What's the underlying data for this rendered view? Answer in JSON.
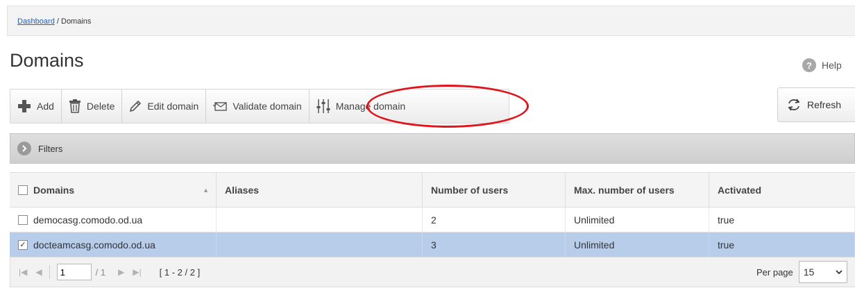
{
  "breadcrumb": {
    "link": "Dashboard",
    "separator": " / ",
    "current": "Domains"
  },
  "page": {
    "title": "Domains"
  },
  "help": {
    "label": "Help",
    "icon": "question-icon"
  },
  "toolbar": {
    "add": "Add",
    "delete": "Delete",
    "edit": "Edit domain",
    "validate": "Validate domain",
    "manage": "Manage domain",
    "refresh": "Refresh"
  },
  "filters": {
    "label": "Filters"
  },
  "table": {
    "columns": [
      "Domains",
      "Aliases",
      "Number of users",
      "Max. number of users",
      "Activated"
    ],
    "rows": [
      {
        "domain": "democasg.comodo.od.ua",
        "aliases": "",
        "users": "2",
        "max_users": "Unlimited",
        "activated": "true",
        "checked": false,
        "selected": false
      },
      {
        "domain": "docteamcasg.comodo.od.ua",
        "aliases": "",
        "users": "3",
        "max_users": "Unlimited",
        "activated": "true",
        "checked": true,
        "selected": true
      }
    ]
  },
  "pager": {
    "page": "1",
    "total": "/ 1",
    "range": "[ 1 - 2 / 2 ]",
    "per_page_label": "Per page",
    "per_page_value": "15"
  },
  "colors": {
    "highlight_circle": "#e0141a",
    "selected_row": "#b7cdea",
    "link": "#1f5fbf"
  }
}
